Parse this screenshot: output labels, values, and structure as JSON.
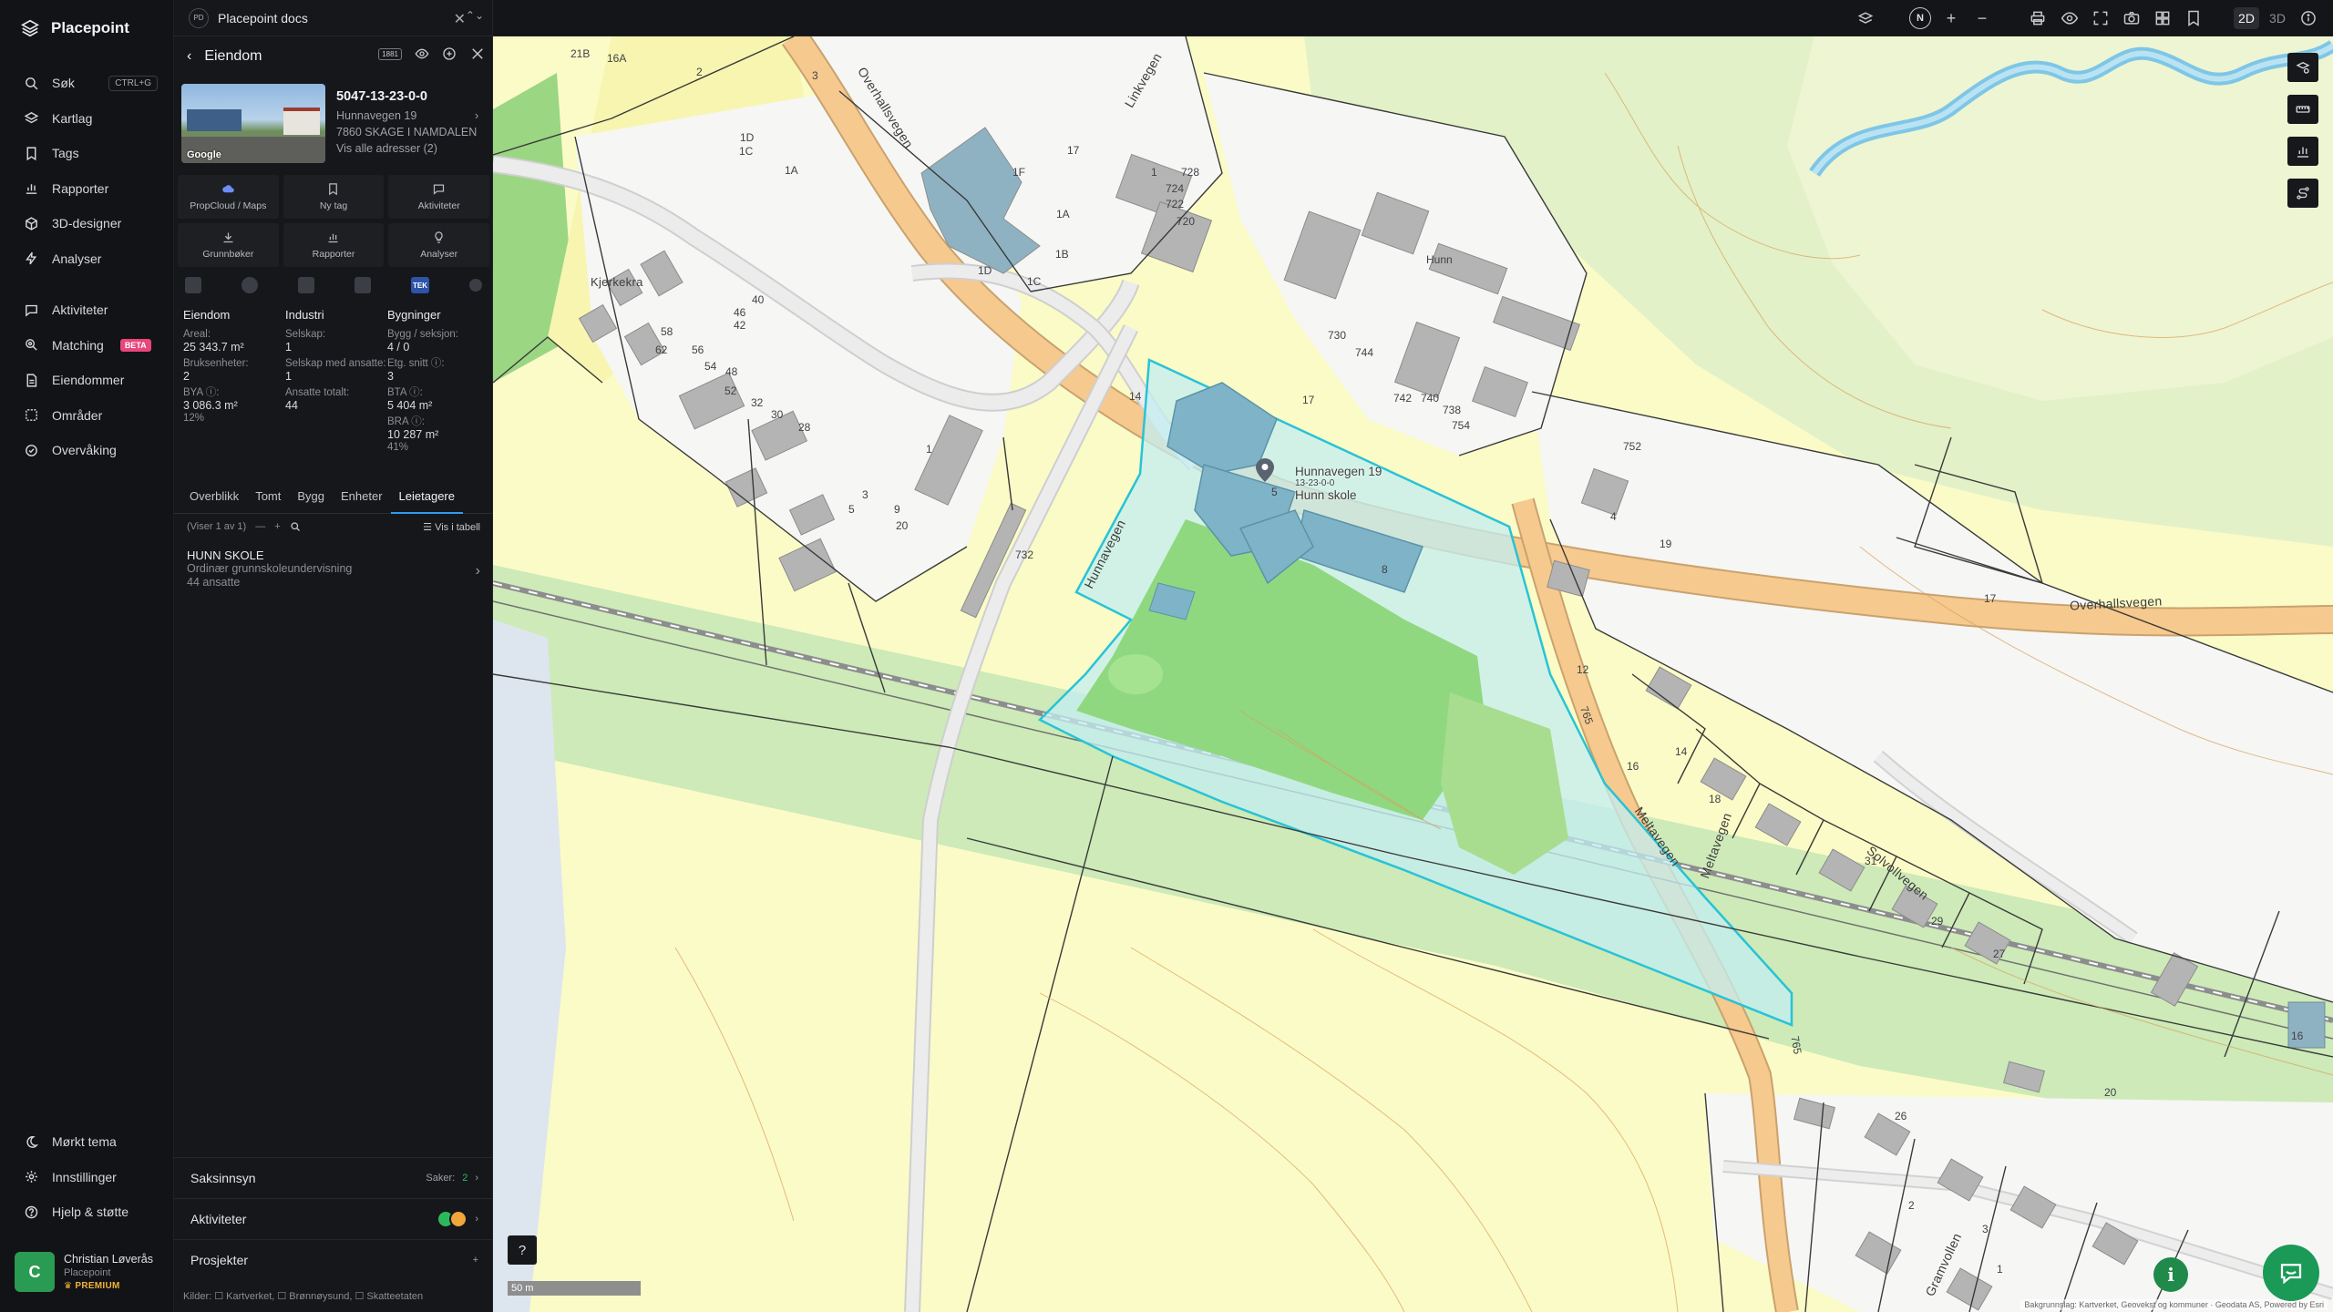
{
  "app": {
    "name": "Placepoint"
  },
  "nav": {
    "search": {
      "label": "Søk",
      "shortcut": "CTRL+G"
    },
    "items_top": [
      "Kartlag",
      "Tags",
      "Rapporter",
      "3D-designer",
      "Analyser"
    ],
    "items_mid": [
      "Aktiviteter",
      "Matching",
      "Eiendommer",
      "Områder",
      "Overvåking"
    ],
    "matching_badge": "BETA",
    "items_bottom": [
      "Mørkt tema",
      "Innstillinger",
      "Hjelp & støtte"
    ]
  },
  "user": {
    "initial": "C",
    "name": "Christian Løverås",
    "org": "Placepoint",
    "tier": "PREMIUM"
  },
  "doc_tab": {
    "badge": "PD",
    "title": "Placepoint docs"
  },
  "panel": {
    "title": "Eiendom",
    "tag_1881": "1881",
    "photo_credit": "Google",
    "property_id": "5047-13-23-0-0",
    "address": "Hunnavegen 19",
    "postal": "7860 SKAGE I NAMDALEN",
    "all_addresses": "Vis alle adresser (2)",
    "actions": [
      "PropCloud / Maps",
      "Ny tag",
      "Aktiviteter",
      "Grunnbøker",
      "Rapporter",
      "Analyser"
    ],
    "source_tek": "TEK",
    "stats": {
      "eiendom": {
        "heading": "Eiendom",
        "areal_label": "Areal:",
        "areal_value": "25 343.7 m²",
        "bruksenheter_label": "Bruksenheter:",
        "bruksenheter_value": "2",
        "bya_label": "BYA ⓘ:",
        "bya_value": "3 086.3 m²",
        "bya_pct": "12%"
      },
      "industri": {
        "heading": "Industri",
        "selskap_label": "Selskap:",
        "selskap_value": "1",
        "ansatte_label": "Selskap med ansatte:",
        "ansatte_value": "1",
        "totalt_label": "Ansatte totalt:",
        "totalt_value": "44"
      },
      "bygninger": {
        "heading": "Bygninger",
        "bygg_label": "Bygg / seksjon:",
        "bygg_value": "4 / 0",
        "etg_label": "Etg. snitt ⓘ:",
        "etg_value": "3",
        "bta_label": "BTA ⓘ:",
        "bta_value": "5 404 m²",
        "bra_label": "BRA ⓘ:",
        "bra_value": "10 287 m²",
        "bra_pct": "41%"
      }
    },
    "tabs": [
      "Overblikk",
      "Tomt",
      "Bygg",
      "Enheter",
      "Leietagere"
    ],
    "active_tab": "Leietagere",
    "list_count": "(Viser 1 av 1)",
    "list_table": "Vis i tabell",
    "tenant": {
      "name": "HUNN SKOLE",
      "desc": "Ordinær grunnskoleundervisning",
      "employees": "44 ansatte"
    },
    "sections": {
      "saksinnsyn": "Saksinnsyn",
      "saker_label": "Saker:",
      "saker_count": "2",
      "aktiviteter": "Aktiviteter",
      "prosjekter": "Prosjekter",
      "prosjekter_add": "+"
    },
    "sources": "Kilder:  ☐ Kartverket,  ☐ Brønnøysund,  ☐ Skatteetaten"
  },
  "toolbar": {
    "north": "N",
    "mode_2d": "2D",
    "mode_3d": "3D",
    "zoom_in": "+",
    "zoom_out": "−"
  },
  "map": {
    "roads": {
      "overhallsvegen_top": "Overhallsvegen",
      "overhallsvegen_right": "Overhallsvegen",
      "hunnavegen": "Hunnavegen",
      "meltavegen": "Meltavegen",
      "meltavegen2": "Meltavegen",
      "solvollvegen": "Solvollvegen",
      "linkvegen": "Linkvegen",
      "gramvollen": "Gramvollen",
      "road_17a": "17",
      "road_17b": "17",
      "road_17c": "17",
      "road_765": "765",
      "road_765b": "765"
    },
    "places": {
      "kjerkekra": "Kjerkekra",
      "hunn": "Hunn"
    },
    "pin_address": "Hunnavegen 19",
    "pin_id": "13-23-0-0",
    "pin_place": "Hunn skole",
    "house_numbers": [
      "21B",
      "16A",
      "2",
      "3",
      "1D",
      "1C",
      "1A",
      "1F",
      "1A",
      "1B",
      "1D",
      "1C",
      "728",
      "724",
      "722",
      "720",
      "1",
      "40",
      "46",
      "42",
      "58",
      "62",
      "56",
      "54",
      "48",
      "52",
      "32",
      "30",
      "28",
      "1",
      "3",
      "5",
      "9",
      "20",
      "14",
      "732",
      "730",
      "744",
      "742",
      "740",
      "738",
      "754",
      "752",
      "4",
      "19",
      "5",
      "8",
      "12",
      "16",
      "14",
      "18",
      "31",
      "29",
      "27",
      "20",
      "16",
      "26",
      "2",
      "3",
      "1"
    ],
    "scale": "50 m",
    "attribution": "Bakgrunnslag: Kartverket, Geovekst og kommuner · Geodata AS, Powered by Esri",
    "help": "?",
    "info": "i"
  }
}
